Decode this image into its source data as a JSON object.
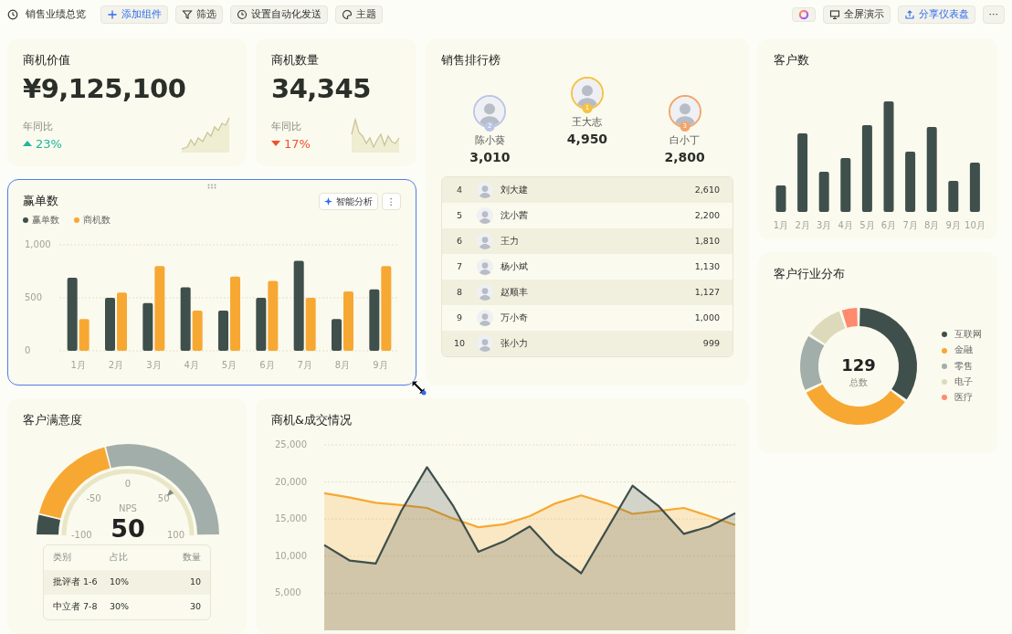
{
  "toolbar": {
    "title": "销售业绩总览",
    "left_buttons": [
      {
        "kind": "add",
        "label": "添加组件"
      },
      {
        "kind": "filter",
        "label": "筛选"
      },
      {
        "kind": "schedule",
        "label": "设置自动化发送"
      },
      {
        "kind": "theme",
        "label": "主题"
      }
    ],
    "right_buttons": [
      {
        "kind": "assistant"
      },
      {
        "kind": "present",
        "label": "全屏演示"
      },
      {
        "kind": "share",
        "label": "分享仪表盘"
      },
      {
        "kind": "more",
        "label": "···"
      }
    ]
  },
  "kpis": [
    {
      "title": "商机价值",
      "value": "¥9,125,100",
      "compare_label": "年同比",
      "kind": "up",
      "change": "23%"
    },
    {
      "title": "商机数量",
      "value": "34,345",
      "compare_label": "年同比",
      "kind": "down",
      "change": "17%"
    }
  ],
  "win_card": {
    "title": "赢单数",
    "selected": true,
    "ai_button": "智能分析",
    "menu_button": "⋮",
    "chart_data": {
      "type": "bar",
      "categories": [
        "1月",
        "2月",
        "3月",
        "4月",
        "5月",
        "6月",
        "7月",
        "8月",
        "9月"
      ],
      "series": [
        {
          "name": "赢单数",
          "color": "#3f4f4b",
          "values": [
            690,
            500,
            450,
            600,
            380,
            500,
            850,
            300,
            580
          ]
        },
        {
          "name": "商机数",
          "color": "#f7a833",
          "values": [
            300,
            550,
            800,
            380,
            700,
            660,
            500,
            560,
            800
          ]
        }
      ],
      "ylim": [
        0,
        1000
      ],
      "grid": true,
      "yticks": [
        0,
        500,
        {
          "value": 1000,
          "label": "1,000"
        }
      ]
    }
  },
  "ranking": {
    "title": "销售排行榜",
    "podium": [
      {
        "kind": "silver",
        "rank": "2",
        "name": "陈小葵",
        "value": "3,010"
      },
      {
        "kind": "gold",
        "rank": "1",
        "name": "王大志",
        "value": "4,950"
      },
      {
        "kind": "bronze",
        "rank": "3",
        "name": "白小丁",
        "value": "2,800"
      }
    ],
    "list": [
      {
        "rank": "4",
        "name": "刘大建",
        "value": "2,610"
      },
      {
        "rank": "5",
        "name": "沈小茜",
        "value": "2,200"
      },
      {
        "rank": "6",
        "name": "王力",
        "value": "1,810"
      },
      {
        "rank": "7",
        "name": "杨小斌",
        "value": "1,130"
      },
      {
        "rank": "8",
        "name": "赵顺丰",
        "value": "1,127"
      },
      {
        "rank": "9",
        "name": "万小奇",
        "value": "1,000"
      },
      {
        "rank": "10",
        "name": "张小力",
        "value": "999"
      }
    ]
  },
  "customers": {
    "title": "客户数",
    "categories": [
      "1月",
      "2月",
      "3月",
      "4月",
      "5月",
      "6月",
      "7月",
      "8月",
      "9月",
      "10月"
    ]
  },
  "industry": {
    "title": "客户行业分布",
    "total": "129",
    "total_label": "总数",
    "legend": [
      {
        "label": "互联网",
        "color": "#3f4f4b"
      },
      {
        "label": "金融",
        "color": "#f7a833"
      },
      {
        "label": "零售",
        "color": "#a2aea9"
      },
      {
        "label": "电子",
        "color": "#dcdabb"
      },
      {
        "label": "医疗",
        "color": "#ff8a6e"
      }
    ]
  },
  "satisfaction": {
    "title": "客户满意度",
    "gauge": {
      "ticks": [
        "-100",
        "-50",
        "0",
        "50",
        "100"
      ],
      "caption": "NPS",
      "value": "50",
      "level": 0.75
    },
    "table": {
      "columns": [
        "类别",
        "占比",
        "数量"
      ],
      "rows": [
        [
          "批评者 1-6",
          "10%",
          "10"
        ],
        [
          "中立者 7-8",
          "30%",
          "30"
        ]
      ]
    }
  },
  "trend": {
    "title": "商机&成交情况",
    "chart_data": {
      "type": "area",
      "categories": [
        null,
        null,
        null,
        null,
        null,
        null,
        null,
        null,
        null,
        null,
        null,
        null,
        null,
        null,
        null,
        null,
        null
      ],
      "series": [
        {
          "color": "#f7a833",
          "values": [
            18500,
            17900,
            17200,
            16900,
            16500,
            15100,
            13900,
            14300,
            15400,
            17100,
            18200,
            17100,
            15700,
            16100,
            16500,
            15400,
            14200
          ]
        },
        {
          "color": "#3f4f4b",
          "values": [
            11500,
            9400,
            9000,
            16100,
            22000,
            16900,
            10600,
            12000,
            14000,
            10300,
            7700,
            13600,
            19500,
            16800,
            13000,
            14000,
            15800
          ]
        }
      ],
      "ylim": [
        0,
        25000
      ],
      "grid": true,
      "yticks": [
        {
          "value": 5000,
          "label": "5,000"
        },
        {
          "value": 10000,
          "label": "10,000"
        },
        {
          "value": 15000,
          "label": "15,000"
        },
        {
          "value": 20000,
          "label": "20,000"
        },
        {
          "value": 25000,
          "label": "25,000"
        }
      ]
    }
  }
}
